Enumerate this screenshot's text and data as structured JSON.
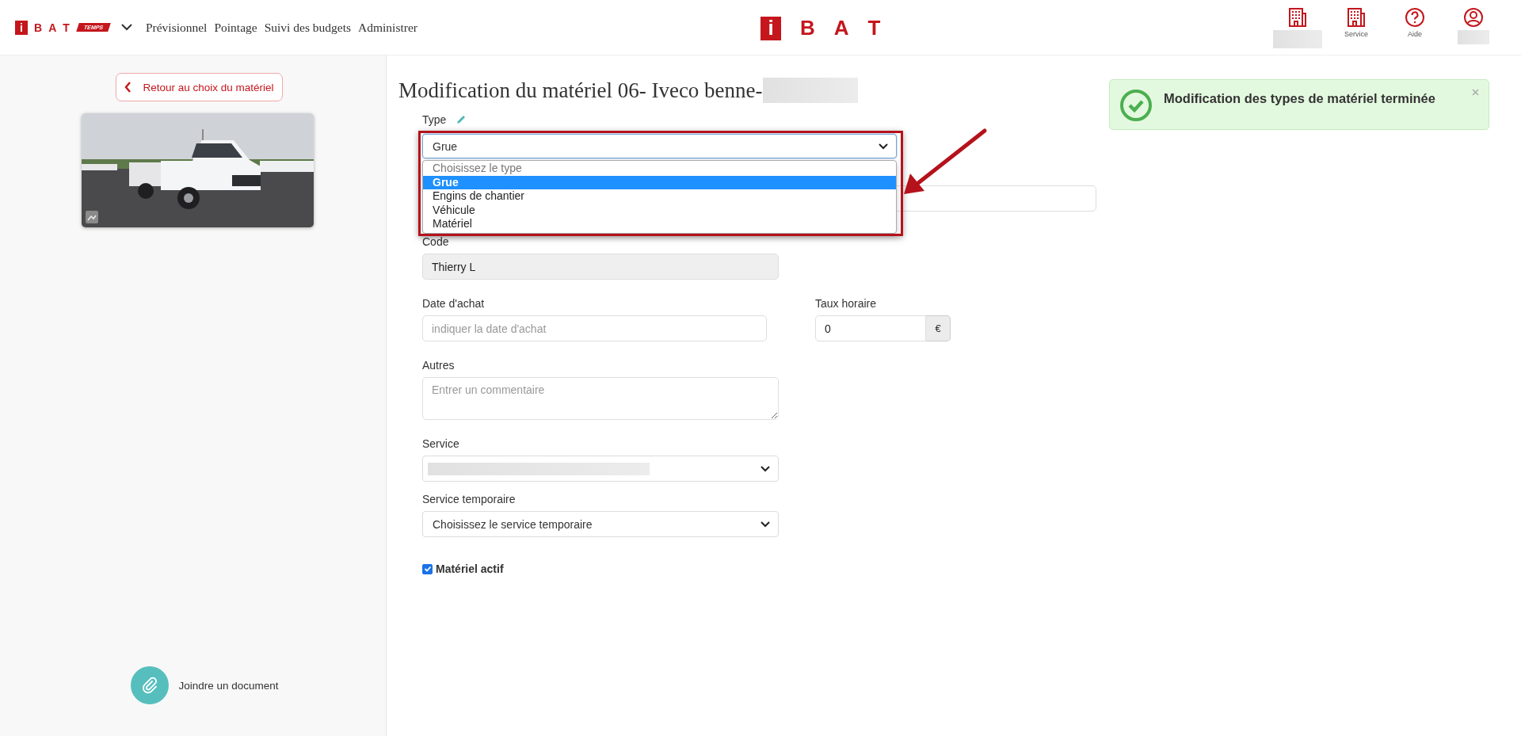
{
  "header": {
    "logo": {
      "mark": "i",
      "letters": [
        "B",
        "A",
        "T"
      ],
      "tag": "TEMPS"
    },
    "nav": [
      "Prévisionnel",
      "Pointage",
      "Suivi des budgets",
      "Administrer"
    ],
    "center_logo": {
      "mark": "i",
      "letters": [
        "B",
        "A",
        "T"
      ]
    },
    "actions": [
      {
        "kind": "building"
      },
      {
        "kind": "building",
        "label": "Service"
      },
      {
        "kind": "help",
        "label": "Aide"
      },
      {
        "kind": "user"
      }
    ]
  },
  "sidebar": {
    "back_button": "Retour au choix du matériel",
    "attach": "Joindre un document"
  },
  "page_title": "Modification du matériel 06- Iveco benne-",
  "form": {
    "type": {
      "label": "Type",
      "value": "Grue",
      "expanded": true,
      "options": [
        {
          "label": "Choisissez le type",
          "selected": false,
          "disabled": true
        },
        {
          "label": "Grue",
          "selected": true,
          "disabled": false
        },
        {
          "label": "Engins de chantier",
          "selected": false,
          "disabled": false
        },
        {
          "label": "Véhicule",
          "selected": false,
          "disabled": false
        },
        {
          "label": "Matériel",
          "selected": false,
          "disabled": false
        }
      ]
    },
    "code": {
      "label": "Code",
      "value": "Thierry L",
      "disabled": true
    },
    "purchase_date": {
      "label": "Date d'achat",
      "placeholder": "indiquer la date d'achat"
    },
    "hourly_rate": {
      "label": "Taux horaire",
      "value": "0",
      "unit": "€"
    },
    "other": {
      "label": "Autres",
      "placeholder": "Entrer un commentaire"
    },
    "service": {
      "label": "Service"
    },
    "temp_service": {
      "label": "Service temporaire",
      "value": "Choisissez le service temporaire"
    },
    "active": {
      "label": "Matériel actif",
      "checked": true
    }
  },
  "toast": {
    "message": "Modification des types de matériel terminée"
  }
}
